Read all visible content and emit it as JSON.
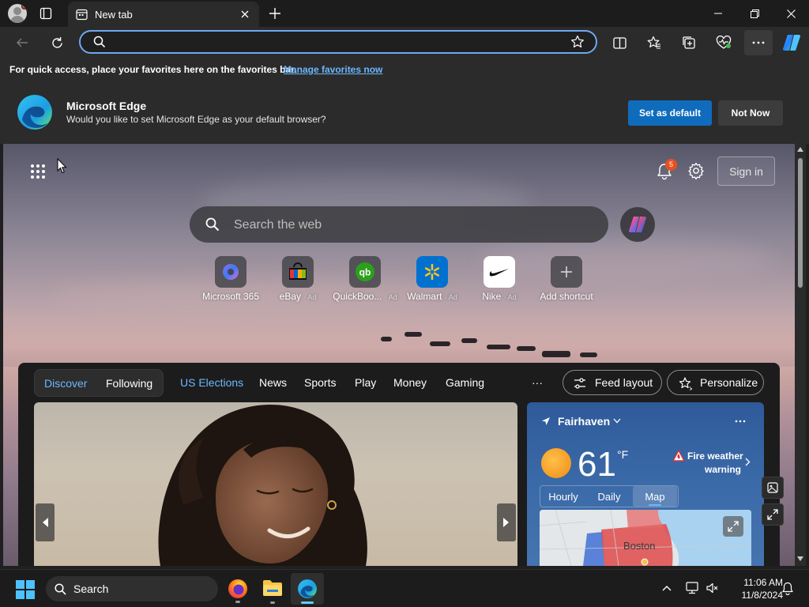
{
  "browser": {
    "tab_title": "New tab",
    "address_value": "",
    "favorites_bar": {
      "text": "For quick access, place your favorites here on the favorites bar.",
      "link": "Manage favorites now"
    },
    "default_banner": {
      "title": "Microsoft Edge",
      "subtitle": "Would you like to set Microsoft Edge as your default browser?",
      "primary_button": "Set as default",
      "secondary_button": "Not Now"
    }
  },
  "newtab": {
    "notification_count": "5",
    "sign_in_label": "Sign in",
    "search_placeholder": "Search the web",
    "shortcuts": [
      {
        "label": "Microsoft 365",
        "ad": "",
        "icon": "microsoft-365-icon"
      },
      {
        "label": "eBay",
        "ad": "· Ad",
        "icon": "ebay-icon"
      },
      {
        "label": "QuickBoo...",
        "ad": "· Ad",
        "icon": "quickbooks-icon"
      },
      {
        "label": "Walmart",
        "ad": "· Ad",
        "icon": "walmart-icon"
      },
      {
        "label": "Nike",
        "ad": "· Ad",
        "icon": "nike-icon"
      },
      {
        "label": "Add shortcut",
        "ad": "",
        "icon": "plus-icon"
      }
    ]
  },
  "feed": {
    "toggle": {
      "discover": "Discover",
      "following": "Following"
    },
    "nav": [
      "US Elections",
      "News",
      "Sports",
      "Play",
      "Money",
      "Gaming"
    ],
    "more": "···",
    "feed_layout": "Feed layout",
    "personalize": "Personalize",
    "weather": {
      "location": "Fairhaven",
      "temperature": "61",
      "unit": "°F",
      "alert_line1": "Fire weather",
      "alert_line2": "warning",
      "tabs": [
        "Hourly",
        "Daily",
        "Map"
      ],
      "map_label": "Boston"
    }
  },
  "taskbar": {
    "search_label": "Search",
    "time": "11:06 AM",
    "date": "11/8/2024"
  }
}
